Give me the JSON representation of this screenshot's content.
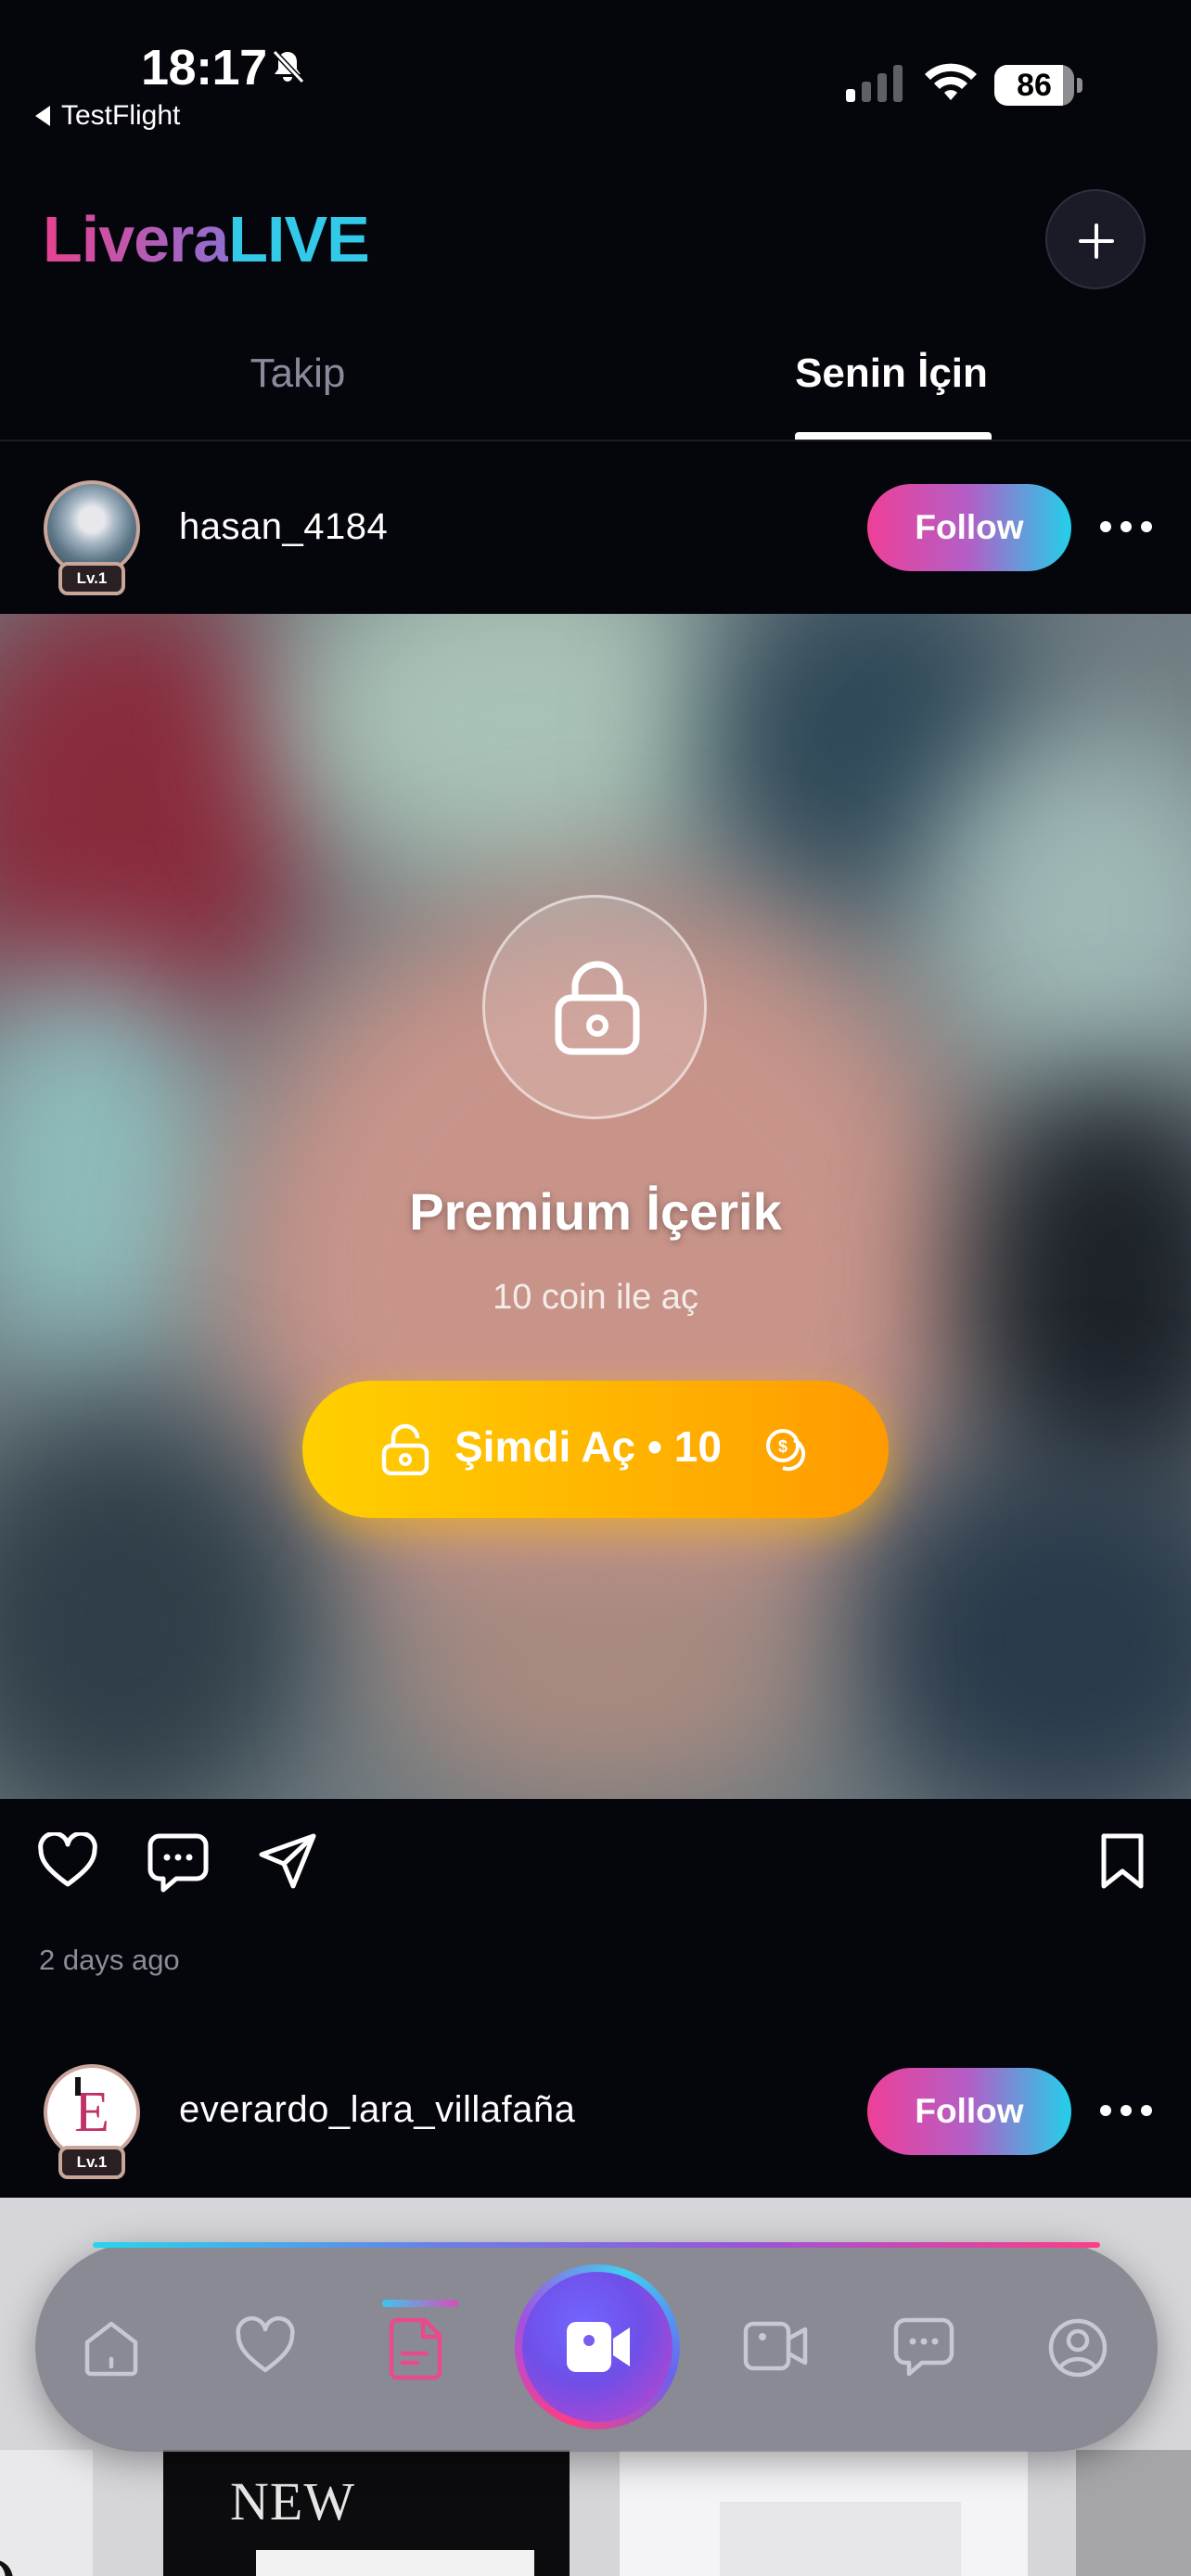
{
  "status_bar": {
    "time": "18:17",
    "back_app": "TestFlight",
    "battery": "86",
    "battery_level": 0.86
  },
  "header": {
    "logo_part1": "Livera",
    "logo_part2": "LIVE",
    "add_icon": "plus-icon"
  },
  "tabs": [
    {
      "label": "Takip",
      "active": false
    },
    {
      "label": "Senin İçin",
      "active": true
    }
  ],
  "posts": [
    {
      "username": "hasan_4184",
      "level": "Lv.1",
      "follow_label": "Follow",
      "locked": true,
      "lock_title": "Premium İçerik",
      "lock_subtitle": "10 coin ile aç",
      "unlock_label": "Şimdi Aç • 10",
      "time_ago": "2 days ago"
    },
    {
      "username": "everardo_lara_villafaña",
      "avatar_letter": "E",
      "level": "Lv.1",
      "follow_label": "Follow"
    }
  ],
  "peek": {
    "poster_text": "NEW",
    "left_text": "O"
  },
  "bottom_nav": {
    "items": [
      "home-icon",
      "heart-icon",
      "posts-icon",
      "live-camera-icon",
      "video-icon",
      "messages-icon",
      "profile-icon"
    ],
    "active": "posts-icon"
  },
  "colors": {
    "background": "#05050c",
    "follow_gradient_start": "#ef3f98",
    "follow_gradient_end": "#22d0ea",
    "unlock_gradient_start": "#ffd000",
    "unlock_gradient_end": "#ff9a00",
    "logo_pink": "#e8428f",
    "logo_cyan": "#33c9e8",
    "active_nav_pink": "#e84a8c"
  }
}
